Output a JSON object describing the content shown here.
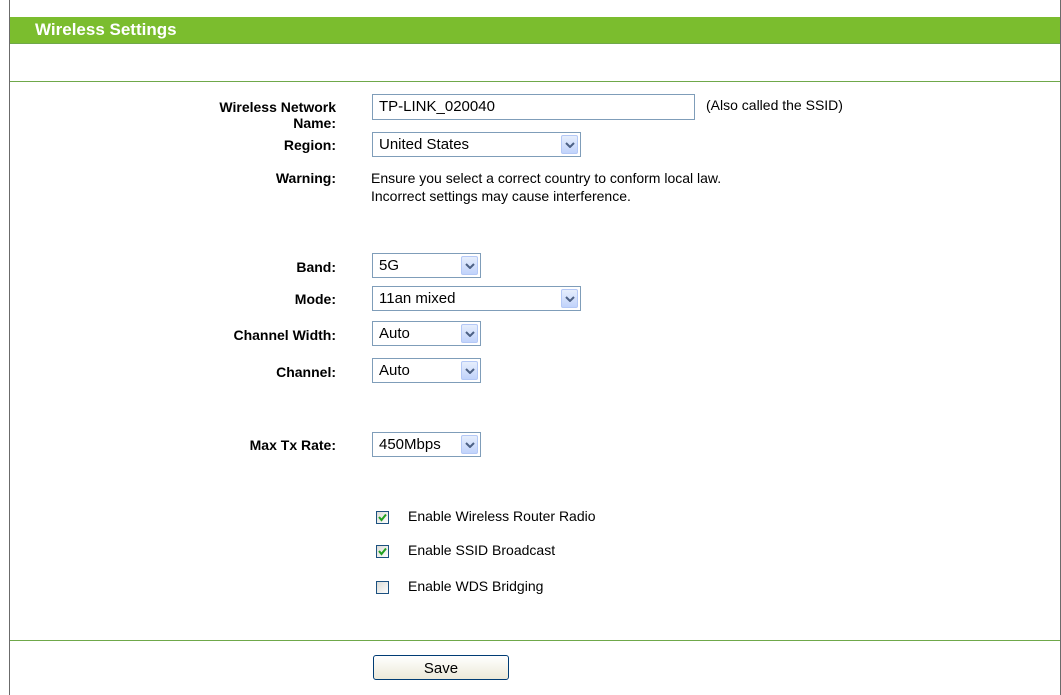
{
  "header": {
    "title": "Wireless Settings"
  },
  "form": {
    "network_name": {
      "label": "Wireless Network Name:",
      "value": "TP-LINK_020040",
      "hint": "(Also called the SSID)"
    },
    "region": {
      "label": "Region:",
      "value": "United States"
    },
    "warning": {
      "label": "Warning:",
      "line1": "Ensure you select a correct country to conform local law.",
      "line2": "Incorrect settings may cause interference."
    },
    "band": {
      "label": "Band:",
      "value": "5G"
    },
    "mode": {
      "label": "Mode:",
      "value": "11an mixed"
    },
    "channel_width": {
      "label": "Channel Width:",
      "value": "Auto"
    },
    "channel": {
      "label": "Channel:",
      "value": "Auto"
    },
    "max_tx_rate": {
      "label": "Max Tx Rate:",
      "value": "450Mbps"
    },
    "options": [
      {
        "label": "Enable Wireless Router Radio",
        "checked": true
      },
      {
        "label": "Enable SSID Broadcast",
        "checked": true
      },
      {
        "label": "Enable WDS Bridging",
        "checked": false
      }
    ]
  },
  "actions": {
    "save_label": "Save"
  },
  "colors": {
    "header_bg": "#7bbd2e",
    "divider": "#6fa84a",
    "input_border": "#7f9db9",
    "check_color": "#21a121"
  },
  "icons": {
    "dropdown": "chevron-down-icon",
    "check": "checkmark-icon"
  }
}
